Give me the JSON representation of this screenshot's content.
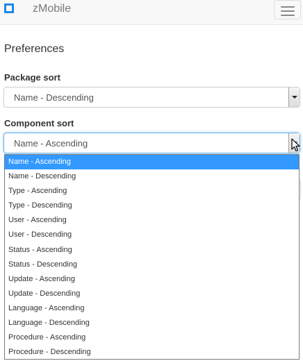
{
  "navbar": {
    "brand": "zMobile"
  },
  "page": {
    "title": "Preferences"
  },
  "package_sort": {
    "label": "Package sort",
    "value": "Name - Descending"
  },
  "component_sort": {
    "label": "Component sort",
    "value": "Name - Ascending",
    "options": [
      "Name - Ascending",
      "Name - Descending",
      "Type - Ascending",
      "Type - Descending",
      "User - Ascending",
      "User - Descending",
      "Status - Ascending",
      "Status - Descending",
      "Update - Ascending",
      "Update - Descending",
      "Language - Ascending",
      "Language - Descending",
      "Procedure - Ascending",
      "Procedure - Descending"
    ]
  },
  "colors": {
    "accent": "#3399ff",
    "logo": "#1e88e5"
  },
  "icons": {
    "logo": "square-logo-icon",
    "menu": "hamburger-menu-icon",
    "cursor": "mouse-pointer-icon",
    "dropdown_arrow": "chevron-down-icon"
  }
}
